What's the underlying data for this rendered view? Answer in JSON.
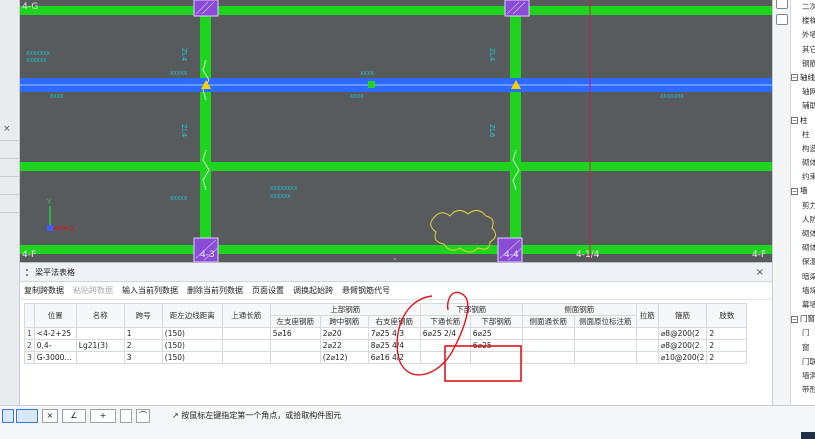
{
  "canvas": {
    "axis_labels": {
      "top_left": "4-G",
      "bottom_left": "4-F",
      "bottom_3": "4-3",
      "bottom_4": "4-4",
      "bottom_14": "4-1/4",
      "bottom_right": "4-F"
    },
    "beam_labels": {
      "zl4_a": "ZL4",
      "zl4_b": "ZL4",
      "zl4_c": "ZL4",
      "zl6": "ZL6"
    },
    "ucs": {
      "x": "X",
      "y": "Y"
    },
    "colors": {
      "background": "#585b5e",
      "beam": "#1fd41f",
      "selected_beam": "#2d6bff",
      "slab": "#5a5d60",
      "column": "#8a4bd6",
      "annotation": "#e0151b"
    }
  },
  "panel": {
    "title": "梁平法表格",
    "close_icon": "×",
    "toolbar": [
      {
        "label": "复制跨数据",
        "enabled": true
      },
      {
        "label": "粘贴跨数据",
        "enabled": false
      },
      {
        "label": "输入当前列数据",
        "enabled": true
      },
      {
        "label": "删除当前列数据",
        "enabled": true
      },
      {
        "label": "页面设置",
        "enabled": true
      },
      {
        "label": "调换起始跨",
        "enabled": true
      },
      {
        "label": "悬臂钢筋代号",
        "enabled": true
      }
    ],
    "group_headers": {
      "upper": "上部钢筋",
      "lower": "下部钢筋",
      "side": "侧面钢筋"
    },
    "columns": [
      "位置",
      "名称",
      "跨号",
      "距左边线距离",
      "上通长筋",
      "左支座钢筋",
      "跨中钢筋",
      "右支座钢筋",
      "下通长筋",
      "下部钢筋",
      "侧面通长筋",
      "侧面原位标注筋",
      "拉筋",
      "箍筋",
      "肢数"
    ],
    "rows": [
      {
        "num": "1",
        "position": "<4-2+25",
        "name": "",
        "span": "1",
        "dist": "(150)",
        "top_through": "",
        "left_support": "5⌀16",
        "mid": "2⌀20",
        "right_support": "7⌀25 4/3",
        "bottom_through": "6⌀25 2/4",
        "bottom": "6⌀25",
        "side_through": "",
        "side_local": "",
        "tie": "",
        "stirrup": "⌀8@200(2",
        "legs": "2"
      },
      {
        "num": "2",
        "position": "0,4-",
        "name": "Lg21(3)",
        "span": "2",
        "dist": "(150)",
        "top_through": "",
        "left_support": "",
        "mid": "2⌀22",
        "right_support": "8⌀25 4/4",
        "bottom_through": "",
        "bottom": "6⌀25",
        "side_through": "",
        "side_local": "",
        "tie": "",
        "stirrup": "⌀8@200(2",
        "legs": "2"
      },
      {
        "num": "3",
        "position": "G-3000...",
        "name": "",
        "span": "3",
        "dist": "(150)",
        "top_through": "",
        "left_support": "",
        "mid": "(2⌀12)",
        "right_support": "6⌀16 4/2",
        "bottom_through": "",
        "bottom": "",
        "side_through": "",
        "side_local": "",
        "tie": "",
        "stirrup": "⌀10@200(2",
        "legs": "2"
      }
    ]
  },
  "right_panel": {
    "tree": [
      {
        "label": "二次",
        "type": "child"
      },
      {
        "label": "楼梯",
        "type": "child"
      },
      {
        "label": "外墙",
        "type": "child"
      },
      {
        "label": "其它",
        "type": "child"
      },
      {
        "label": "钢筋",
        "type": "child"
      },
      {
        "label": "轴线",
        "type": "group"
      },
      {
        "label": "轴网",
        "type": "child"
      },
      {
        "label": "辅助",
        "type": "child"
      },
      {
        "label": "柱",
        "type": "group"
      },
      {
        "label": "柱",
        "type": "child"
      },
      {
        "label": "构造",
        "type": "child"
      },
      {
        "label": "砌体",
        "type": "child"
      },
      {
        "label": "约束",
        "type": "child"
      },
      {
        "label": "墙",
        "type": "group"
      },
      {
        "label": "剪力",
        "type": "child"
      },
      {
        "label": "人防",
        "type": "child"
      },
      {
        "label": "砌体",
        "type": "child"
      },
      {
        "label": "砌体",
        "type": "child"
      },
      {
        "label": "保温",
        "type": "child"
      },
      {
        "label": "暗梁",
        "type": "child"
      },
      {
        "label": "墙垛",
        "type": "child"
      },
      {
        "label": "幕墙",
        "type": "child"
      },
      {
        "label": "门窗",
        "type": "group"
      },
      {
        "label": "门",
        "type": "child"
      },
      {
        "label": "窗",
        "type": "child"
      },
      {
        "label": "门联",
        "type": "child"
      },
      {
        "label": "墙洞",
        "type": "child"
      },
      {
        "label": "带形",
        "type": "child"
      }
    ]
  },
  "status": {
    "hint": "按鼠标左键指定第一个角点，或拾取构件图元"
  }
}
